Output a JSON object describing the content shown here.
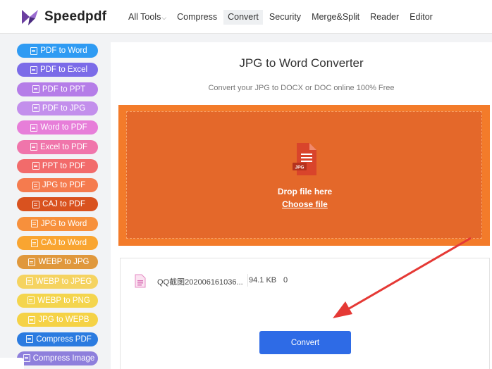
{
  "header": {
    "brand": "Speedpdf",
    "nav": [
      {
        "label": "All Tools",
        "has_caret": true,
        "active": false
      },
      {
        "label": "Compress",
        "active": false
      },
      {
        "label": "Convert",
        "active": true
      },
      {
        "label": "Security",
        "active": false
      },
      {
        "label": "Merge&Split",
        "active": false
      },
      {
        "label": "Reader",
        "active": false
      },
      {
        "label": "Editor",
        "active": false
      }
    ],
    "caret_glyph": "⌵"
  },
  "sidebar": {
    "items": [
      {
        "label": "PDF to Word",
        "color": "#2f9bf3"
      },
      {
        "label": "PDF to Excel",
        "color": "#7b6be8"
      },
      {
        "label": "PDF to PPT",
        "color": "#b57de8"
      },
      {
        "label": "PDF to JPG",
        "color": "#c38fec"
      },
      {
        "label": "Word to PDF",
        "color": "#e77ed9"
      },
      {
        "label": "Excel to PDF",
        "color": "#f075ab"
      },
      {
        "label": "PPT to PDF",
        "color": "#f26b6b"
      },
      {
        "label": "JPG to PDF",
        "color": "#f57b4e"
      },
      {
        "label": "CAJ to PDF",
        "color": "#d9521f"
      },
      {
        "label": "JPG to Word",
        "color": "#f7903c"
      },
      {
        "label": "CAJ to Word",
        "color": "#f9a531"
      },
      {
        "label": "WEBP to JPG",
        "color": "#e0983c"
      },
      {
        "label": "WEBP to JPEG",
        "color": "#f5d360"
      },
      {
        "label": "WEBP to PNG",
        "color": "#f4d54e"
      },
      {
        "label": "JPG to WEPB",
        "color": "#f5d246"
      },
      {
        "label": "Compress PDF",
        "color": "#2b7be0"
      },
      {
        "label": "Compress Image",
        "color": "#8e7fdc"
      }
    ]
  },
  "main": {
    "title": "JPG to Word Converter",
    "subtitle": "Convert your JPG to DOCX or DOC online 100% Free",
    "drop": {
      "text": "Drop file here",
      "choose": "Choose file",
      "icon_label": "JPG"
    },
    "file": {
      "name": "QQ截图202006161036...",
      "size": "94.1 KB",
      "status": "0"
    },
    "convert_label": "Convert"
  },
  "colors": {
    "accent_orange": "#f37b2a",
    "drop_inner": "#e4682a",
    "button_blue": "#2e6be6",
    "arrow_red": "#e53935"
  }
}
